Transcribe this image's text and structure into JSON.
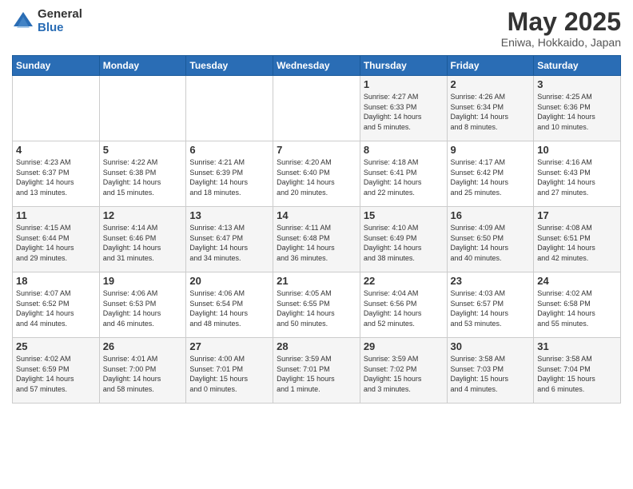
{
  "logo": {
    "general": "General",
    "blue": "Blue"
  },
  "title": {
    "month": "May 2025",
    "location": "Eniwa, Hokkaido, Japan"
  },
  "weekdays": [
    "Sunday",
    "Monday",
    "Tuesday",
    "Wednesday",
    "Thursday",
    "Friday",
    "Saturday"
  ],
  "weeks": [
    [
      {
        "day": "",
        "info": ""
      },
      {
        "day": "",
        "info": ""
      },
      {
        "day": "",
        "info": ""
      },
      {
        "day": "",
        "info": ""
      },
      {
        "day": "1",
        "info": "Sunrise: 4:27 AM\nSunset: 6:33 PM\nDaylight: 14 hours\nand 5 minutes."
      },
      {
        "day": "2",
        "info": "Sunrise: 4:26 AM\nSunset: 6:34 PM\nDaylight: 14 hours\nand 8 minutes."
      },
      {
        "day": "3",
        "info": "Sunrise: 4:25 AM\nSunset: 6:36 PM\nDaylight: 14 hours\nand 10 minutes."
      }
    ],
    [
      {
        "day": "4",
        "info": "Sunrise: 4:23 AM\nSunset: 6:37 PM\nDaylight: 14 hours\nand 13 minutes."
      },
      {
        "day": "5",
        "info": "Sunrise: 4:22 AM\nSunset: 6:38 PM\nDaylight: 14 hours\nand 15 minutes."
      },
      {
        "day": "6",
        "info": "Sunrise: 4:21 AM\nSunset: 6:39 PM\nDaylight: 14 hours\nand 18 minutes."
      },
      {
        "day": "7",
        "info": "Sunrise: 4:20 AM\nSunset: 6:40 PM\nDaylight: 14 hours\nand 20 minutes."
      },
      {
        "day": "8",
        "info": "Sunrise: 4:18 AM\nSunset: 6:41 PM\nDaylight: 14 hours\nand 22 minutes."
      },
      {
        "day": "9",
        "info": "Sunrise: 4:17 AM\nSunset: 6:42 PM\nDaylight: 14 hours\nand 25 minutes."
      },
      {
        "day": "10",
        "info": "Sunrise: 4:16 AM\nSunset: 6:43 PM\nDaylight: 14 hours\nand 27 minutes."
      }
    ],
    [
      {
        "day": "11",
        "info": "Sunrise: 4:15 AM\nSunset: 6:44 PM\nDaylight: 14 hours\nand 29 minutes."
      },
      {
        "day": "12",
        "info": "Sunrise: 4:14 AM\nSunset: 6:46 PM\nDaylight: 14 hours\nand 31 minutes."
      },
      {
        "day": "13",
        "info": "Sunrise: 4:13 AM\nSunset: 6:47 PM\nDaylight: 14 hours\nand 34 minutes."
      },
      {
        "day": "14",
        "info": "Sunrise: 4:11 AM\nSunset: 6:48 PM\nDaylight: 14 hours\nand 36 minutes."
      },
      {
        "day": "15",
        "info": "Sunrise: 4:10 AM\nSunset: 6:49 PM\nDaylight: 14 hours\nand 38 minutes."
      },
      {
        "day": "16",
        "info": "Sunrise: 4:09 AM\nSunset: 6:50 PM\nDaylight: 14 hours\nand 40 minutes."
      },
      {
        "day": "17",
        "info": "Sunrise: 4:08 AM\nSunset: 6:51 PM\nDaylight: 14 hours\nand 42 minutes."
      }
    ],
    [
      {
        "day": "18",
        "info": "Sunrise: 4:07 AM\nSunset: 6:52 PM\nDaylight: 14 hours\nand 44 minutes."
      },
      {
        "day": "19",
        "info": "Sunrise: 4:06 AM\nSunset: 6:53 PM\nDaylight: 14 hours\nand 46 minutes."
      },
      {
        "day": "20",
        "info": "Sunrise: 4:06 AM\nSunset: 6:54 PM\nDaylight: 14 hours\nand 48 minutes."
      },
      {
        "day": "21",
        "info": "Sunrise: 4:05 AM\nSunset: 6:55 PM\nDaylight: 14 hours\nand 50 minutes."
      },
      {
        "day": "22",
        "info": "Sunrise: 4:04 AM\nSunset: 6:56 PM\nDaylight: 14 hours\nand 52 minutes."
      },
      {
        "day": "23",
        "info": "Sunrise: 4:03 AM\nSunset: 6:57 PM\nDaylight: 14 hours\nand 53 minutes."
      },
      {
        "day": "24",
        "info": "Sunrise: 4:02 AM\nSunset: 6:58 PM\nDaylight: 14 hours\nand 55 minutes."
      }
    ],
    [
      {
        "day": "25",
        "info": "Sunrise: 4:02 AM\nSunset: 6:59 PM\nDaylight: 14 hours\nand 57 minutes."
      },
      {
        "day": "26",
        "info": "Sunrise: 4:01 AM\nSunset: 7:00 PM\nDaylight: 14 hours\nand 58 minutes."
      },
      {
        "day": "27",
        "info": "Sunrise: 4:00 AM\nSunset: 7:01 PM\nDaylight: 15 hours\nand 0 minutes."
      },
      {
        "day": "28",
        "info": "Sunrise: 3:59 AM\nSunset: 7:01 PM\nDaylight: 15 hours\nand 1 minute."
      },
      {
        "day": "29",
        "info": "Sunrise: 3:59 AM\nSunset: 7:02 PM\nDaylight: 15 hours\nand 3 minutes."
      },
      {
        "day": "30",
        "info": "Sunrise: 3:58 AM\nSunset: 7:03 PM\nDaylight: 15 hours\nand 4 minutes."
      },
      {
        "day": "31",
        "info": "Sunrise: 3:58 AM\nSunset: 7:04 PM\nDaylight: 15 hours\nand 6 minutes."
      }
    ]
  ]
}
